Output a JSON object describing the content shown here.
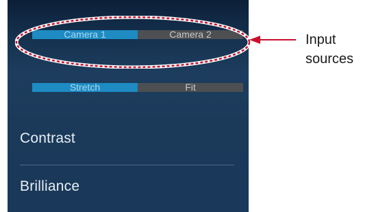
{
  "input_sources": {
    "options": [
      {
        "label": "Camera 1",
        "selected": true
      },
      {
        "label": "Camera 2",
        "selected": false
      }
    ]
  },
  "scaling": {
    "options": [
      {
        "label": "Stretch",
        "selected": true
      },
      {
        "label": "Fit",
        "selected": false
      }
    ]
  },
  "menu": {
    "contrast_label": "Contrast",
    "brilliance_label": "Brilliance"
  },
  "callout": {
    "line1": "Input",
    "line2": "sources"
  },
  "colors": {
    "accent": "#1e8bc3",
    "inactive": "#4d4f52",
    "callout_red": "#c8102e"
  }
}
